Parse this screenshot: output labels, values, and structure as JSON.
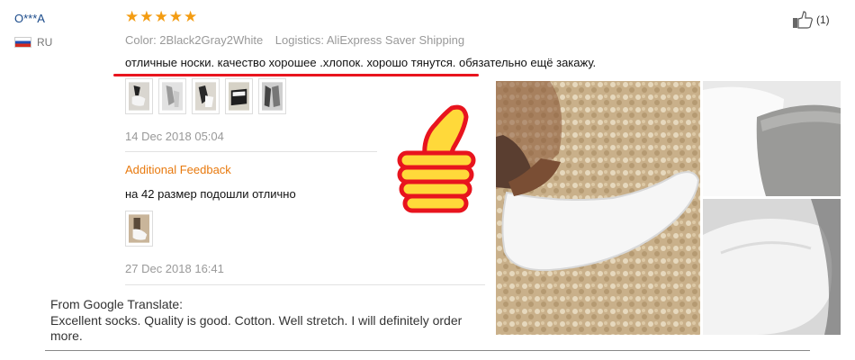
{
  "user": {
    "name": "O***A",
    "country": "RU",
    "flag_icon": "russia-flag-icon"
  },
  "rating": {
    "stars": 5,
    "max": 5,
    "color": "#f39c12"
  },
  "meta": {
    "color": "Color: 2Black2Gray2White",
    "logistics": "Logistics: AliExpress Saver Shipping"
  },
  "review": {
    "text": "отличные носки. качество хорошее .хлопок. хорошо тянутся. обязательно ещё закажу.",
    "date": "14 Dec 2018 05:04"
  },
  "additional": {
    "label": "Additional Feedback",
    "text": "на 42 размер подошли отлично",
    "date": "27 Dec 2018 16:41"
  },
  "translation": {
    "label": "From Google Translate:",
    "text": "Excellent socks. Quality is good. Cotton. Well stretch. I will definitely order more."
  },
  "helpful": {
    "icon": "thumbs-up-icon",
    "count": "(1)"
  },
  "colors": {
    "accent_orange": "#e8790d",
    "underline_red": "#e8141e",
    "user_link": "#1a4a8a"
  }
}
